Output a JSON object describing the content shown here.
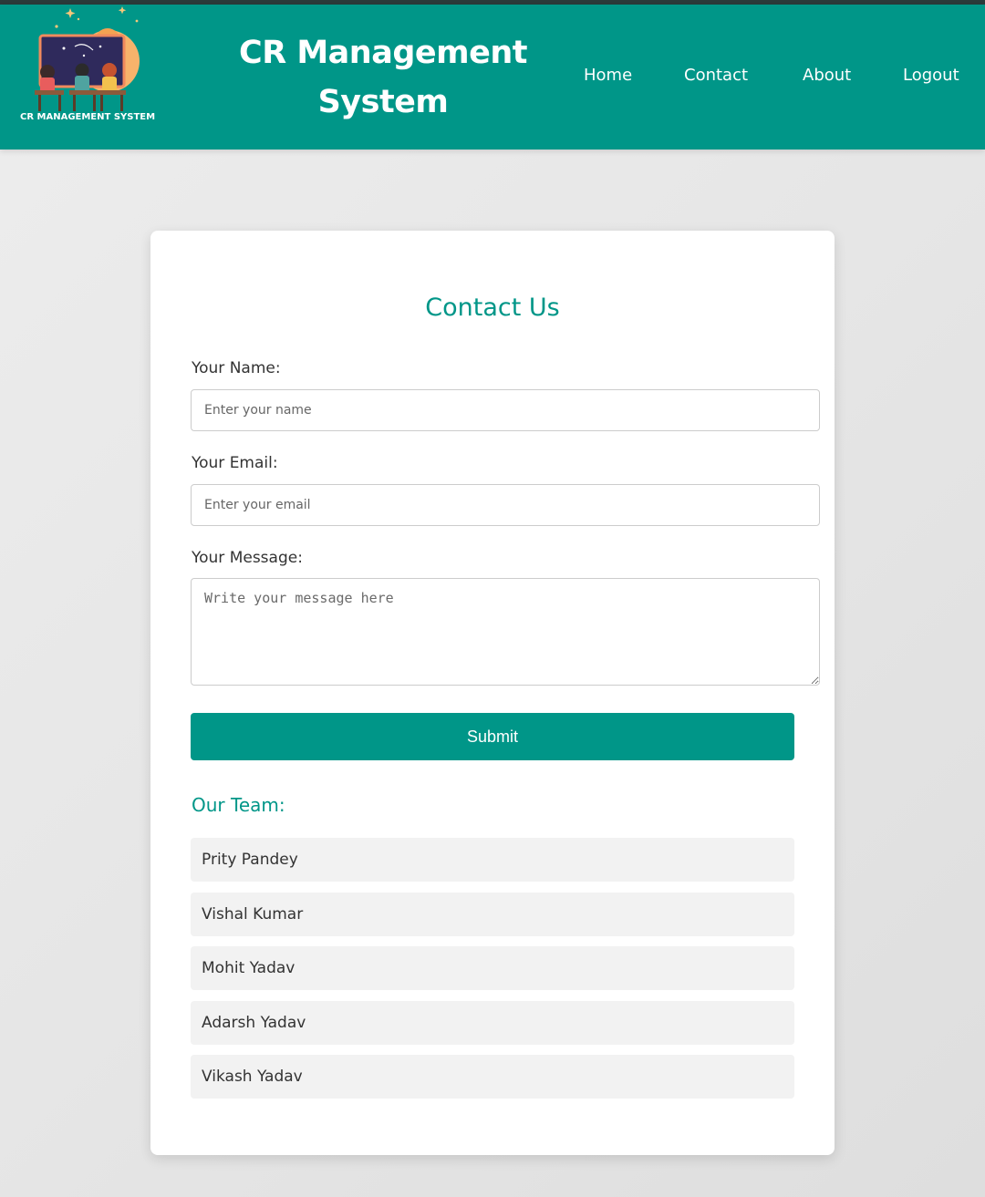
{
  "header": {
    "logo_caption": "CR MANAGEMENT SYSTEM",
    "brand_line1": "CR Management",
    "brand_line2": "System",
    "nav": {
      "home": "Home",
      "contact": "Contact",
      "about": "About",
      "logout": "Logout"
    },
    "colors": {
      "primary": "#009688",
      "top_strip": "#2b3a3a",
      "text_on_primary": "#ffffff"
    }
  },
  "contact_form": {
    "title": "Contact Us",
    "name_label": "Your Name:",
    "name_placeholder": "Enter your name",
    "name_value": "",
    "email_label": "Your Email:",
    "email_placeholder": "Enter your email",
    "email_value": "",
    "message_label": "Your Message:",
    "message_placeholder": "Write your message here",
    "message_value": "",
    "submit_label": "Submit"
  },
  "team": {
    "heading": "Our Team:",
    "members": [
      "Prity Pandey",
      "Vishal Kumar",
      "Mohit Yadav",
      "Adarsh Yadav",
      "Vikash Yadav"
    ]
  },
  "icons": {
    "logo": "classroom-illustration-logo"
  }
}
